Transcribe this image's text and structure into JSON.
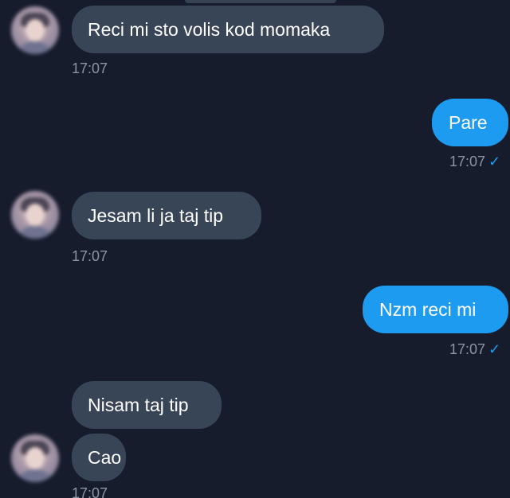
{
  "messages": [
    {
      "side": "in",
      "text": "Reci mi sto volis kod momaka",
      "time": "17:07"
    },
    {
      "side": "out",
      "text": "Pare",
      "time": "17:07"
    },
    {
      "side": "in",
      "text": "Jesam li ja taj tip",
      "time": "17:07"
    },
    {
      "side": "out",
      "text": "Nzm reci mi",
      "time": "17:07"
    },
    {
      "side": "in",
      "text": "Nisam taj tip",
      "time": ""
    },
    {
      "side": "in",
      "text": "Cao",
      "time": "17:07"
    }
  ],
  "read_icon": "checkmark-icon",
  "read_glyph": "✓",
  "colors": {
    "background": "#161c2c",
    "incoming_bubble": "#384556",
    "outgoing_bubble": "#1d9bf0",
    "timestamp": "#8a95a4",
    "read_check": "#1d9bf0"
  }
}
